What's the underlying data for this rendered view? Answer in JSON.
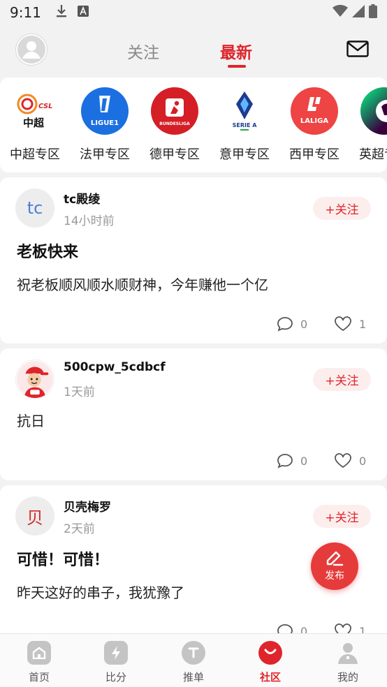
{
  "status": {
    "time": "9:11"
  },
  "nav": {
    "tab_follow": "关注",
    "tab_latest": "最新"
  },
  "leagues": [
    {
      "name": "中超专区",
      "logo_text": "中超",
      "logo_sub": "CSL",
      "color": "#d62828"
    },
    {
      "name": "法甲专区",
      "logo_text": "LIGUE1",
      "color": "#1b6fe0"
    },
    {
      "name": "德甲专区",
      "logo_text": "BUNDESLIGA",
      "color": "#d41f26"
    },
    {
      "name": "意甲专区",
      "logo_text": "SERIE A",
      "color": "#1d3c8f"
    },
    {
      "name": "西甲专区",
      "logo_text": "LALIGA",
      "color": "#ee4444"
    },
    {
      "name": "英超专区",
      "color": "#38003c"
    }
  ],
  "posts": [
    {
      "author": "tc殿绫",
      "avatar_text": "tc",
      "time": "14小时前",
      "follow_label": "+关注",
      "title": "老板快来",
      "body": "祝老板顺风顺水顺财神，今年赚他一个亿",
      "comments": "0",
      "likes": "1"
    },
    {
      "author": "500cpw_5cdbcf",
      "time": "1天前",
      "follow_label": "+关注",
      "body": "抗日",
      "comments": "0",
      "likes": "0"
    },
    {
      "author": "贝壳梅罗",
      "avatar_text": "贝",
      "time": "2天前",
      "follow_label": "+关注",
      "title": "可惜！可惜！",
      "body": "昨天这好的串子，我犹豫了",
      "comments": "0",
      "likes": "1"
    }
  ],
  "fab": {
    "label": "发布"
  },
  "bottom_nav": [
    {
      "label": "首页"
    },
    {
      "label": "比分"
    },
    {
      "label": "推单"
    },
    {
      "label": "社区",
      "active": true
    },
    {
      "label": "我的"
    }
  ],
  "colors": {
    "accent": "#e0242b",
    "background": "#f2f2f2"
  }
}
